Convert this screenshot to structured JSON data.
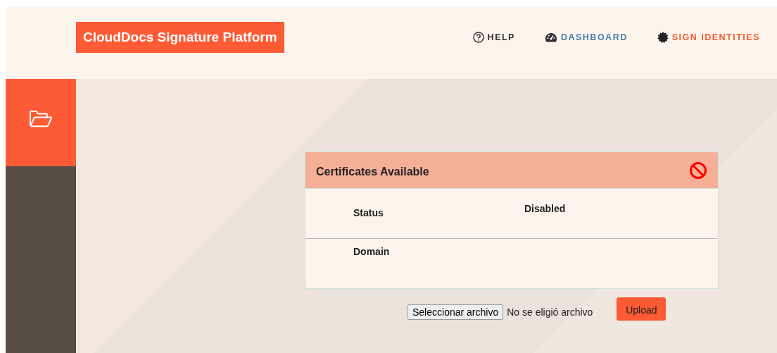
{
  "header": {
    "logo": "CloudDocs Signature Platform",
    "nav": [
      {
        "label": "HELP",
        "kind": "help",
        "color": "#333333"
      },
      {
        "label": "DASHBOARD",
        "kind": "dashboard",
        "color": "#4a7fb0"
      },
      {
        "label": "SIGN IDENTITIES",
        "kind": "identities",
        "color": "#f35b35"
      }
    ]
  },
  "sidebar": {
    "items": [
      {
        "selected": true
      }
    ]
  },
  "card": {
    "title": "Certificates Available",
    "disabled": true,
    "rows": [
      {
        "label": "Status",
        "value": "Disabled"
      },
      {
        "label": "Domain"
      }
    ]
  },
  "upload": {
    "file_button": "Seleccionar archivo",
    "file_status": "No se eligió archivo",
    "button": "Upload"
  }
}
